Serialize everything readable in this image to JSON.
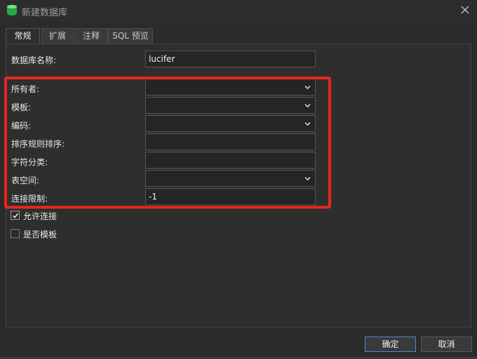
{
  "window": {
    "title": "新建数据库"
  },
  "tabs": [
    {
      "label": "常规",
      "active": true
    },
    {
      "label": "扩展",
      "active": false
    },
    {
      "label": "注释",
      "active": false
    },
    {
      "label": "SQL 预览",
      "active": false
    }
  ],
  "form": {
    "db_name_label": "数据库名称:",
    "db_name_value": "lucifer",
    "owner_label": "所有者:",
    "owner_value": "",
    "template_label": "模板:",
    "template_value": "",
    "encoding_label": "编码:",
    "encoding_value": "",
    "collation_label": "排序规则排序:",
    "collation_value": "",
    "ctype_label": "字符分类:",
    "ctype_value": "",
    "tablespace_label": "表空间:",
    "tablespace_value": "",
    "conn_limit_label": "连接限制:",
    "conn_limit_value": "-1"
  },
  "options": {
    "allow_conn_label": "允许连接",
    "allow_conn_checked": true,
    "is_template_label": "是否模板",
    "is_template_checked": false
  },
  "buttons": {
    "ok_label": "确定",
    "cancel_label": "取消"
  },
  "colors": {
    "highlight_box": "#e6271f",
    "primary_button_border": "#4a8bd6",
    "app_icon": "#27a84a"
  },
  "icons": {
    "app": "database-icon",
    "close": "close-icon",
    "dropdown": "chevron-down-icon",
    "check": "checkmark-icon"
  }
}
